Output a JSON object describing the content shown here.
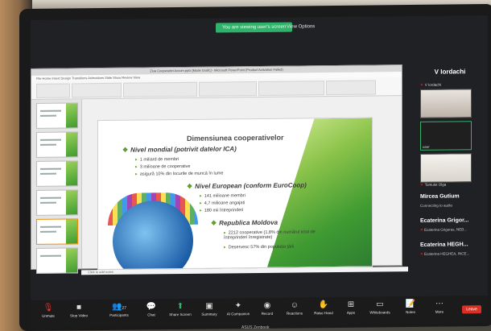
{
  "meeting": {
    "share_banner": "You are viewing user's screen",
    "view_options": "View Options"
  },
  "powerpoint": {
    "window_title": "Ziua Cooperatiei Accum.pptx [Mode Grafic] - Microsoft PowerPoint (Product Activation Failed)",
    "menu": "File  Home  Insert  Design  Transitions  Animations  Slide Show  Review  View",
    "notes_placeholder": "Click to add notes"
  },
  "slide": {
    "title": "Dimensiunea cooperativelor",
    "sections": [
      {
        "heading": "Nivel mondial (potrivit datelor ICA)",
        "items": [
          "1 miliard de membri",
          "3 milioane de cooperative",
          "asigură 10% din locurile de muncă în lume"
        ]
      },
      {
        "heading": "Nivel European (conform EuroCoop)",
        "items": [
          "141 milioane membri",
          "4,7 milioane angajati",
          "180 mii întreprinderi"
        ]
      },
      {
        "heading": "Republica Moldova",
        "items": [
          "2212 cooperative (1,8% din numărul total de întreprinderi înregistrate)",
          "Deservesc 57% din populația țării"
        ]
      }
    ]
  },
  "participants": {
    "speaker_name": "V Iordachi",
    "tiles": [
      {
        "caption": "V Iordachi"
      },
      {
        "caption": "user"
      },
      {
        "caption": "Tomulet Olga"
      }
    ],
    "list": [
      {
        "name": "Mircea Gutium",
        "status": "Connecting to audio"
      },
      {
        "name": "Ecaterina Grigor...",
        "status": "Ecaterina Grigoras, NEB..."
      },
      {
        "name": "Ecaterina HEGH...",
        "status": "Ecaterina HEGHEA, INCE..."
      }
    ]
  },
  "toolbar": {
    "unmute": "Unmute",
    "stop_video": "Stop Video",
    "participants": "Participants",
    "participants_count": "27",
    "chat": "Chat",
    "share_screen": "Share Screen",
    "summary": "Summary",
    "ai_companion": "AI Companion",
    "record": "Record",
    "reactions": "Reactions",
    "raise_hand": "Raise Hand",
    "apps": "Apps",
    "whiteboards": "Whiteboards",
    "notes": "Notes",
    "more": "More",
    "leave": "Leave"
  },
  "brand": "ASUS Zenbook"
}
